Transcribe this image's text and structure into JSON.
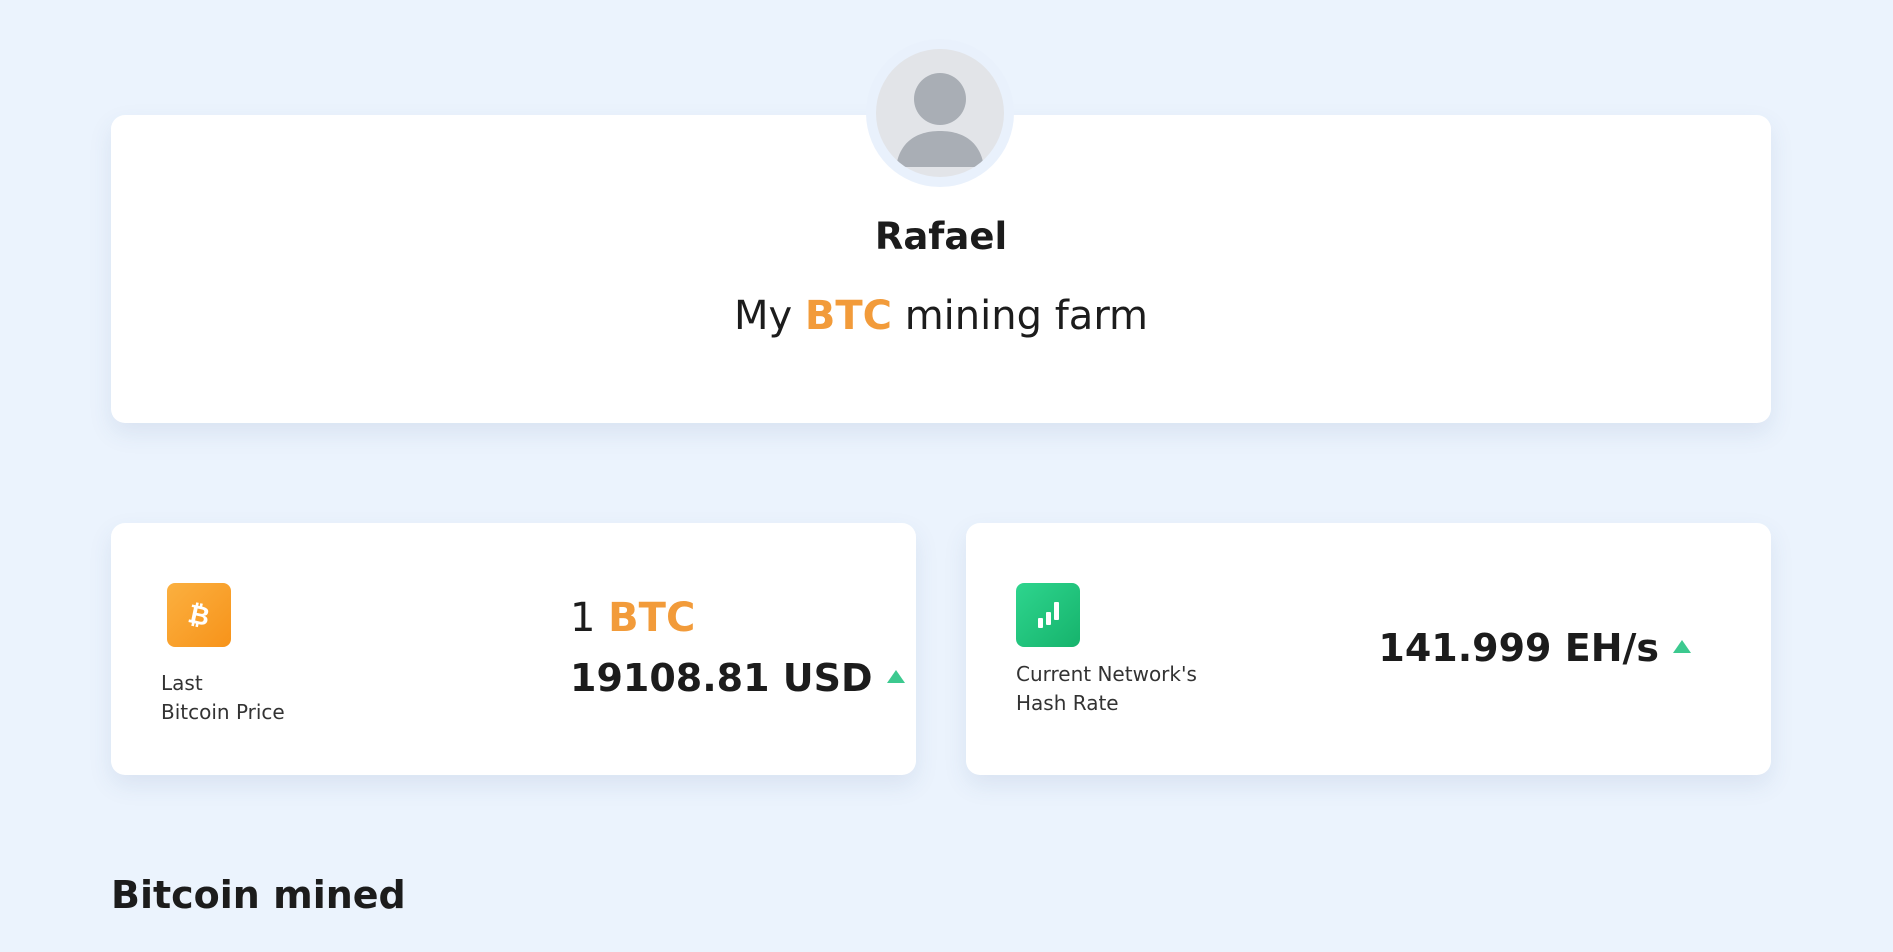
{
  "profile": {
    "name": "Rafael",
    "tagline_prefix": "My",
    "tagline_accent": "BTC",
    "tagline_suffix": "mining farm"
  },
  "price_card": {
    "icon": "bitcoin-icon",
    "label_line1": "Last",
    "label_line2": "Bitcoin Price",
    "unit_amount": "1",
    "unit_currency": "BTC",
    "price": "19108.81 USD",
    "trend": "up"
  },
  "hash_card": {
    "icon": "chart-bars-icon",
    "label_line1": "Current Network's",
    "label_line2": "Hash Rate",
    "value": "141.999 EH/s",
    "trend": "up"
  },
  "section": {
    "title": "Bitcoin mined"
  },
  "colors": {
    "background": "#ebf3fd",
    "accent": "#f29b3a",
    "trend_up": "#3cc98f",
    "btc_icon": "#f7931a",
    "hash_icon": "#16b36c"
  }
}
